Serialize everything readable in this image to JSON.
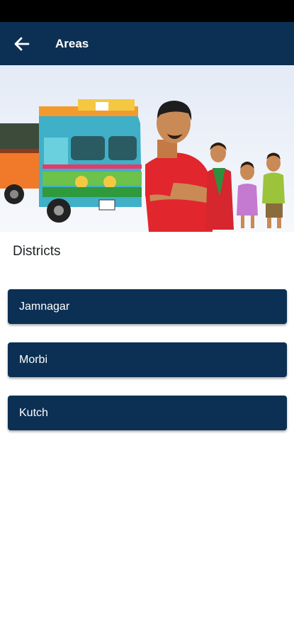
{
  "app_bar": {
    "title": "Areas",
    "back_icon": "arrow-left-icon",
    "background": "#0c3054"
  },
  "banner": {
    "description_icon": "truck-family-illustration"
  },
  "section": {
    "label": "Districts"
  },
  "districts": [
    {
      "label": "Jamnagar"
    },
    {
      "label": "Morbi"
    },
    {
      "label": "Kutch"
    }
  ],
  "colors": {
    "primary": "#0c3054",
    "text_dark": "#1f2326",
    "on_primary": "#ffffff"
  }
}
